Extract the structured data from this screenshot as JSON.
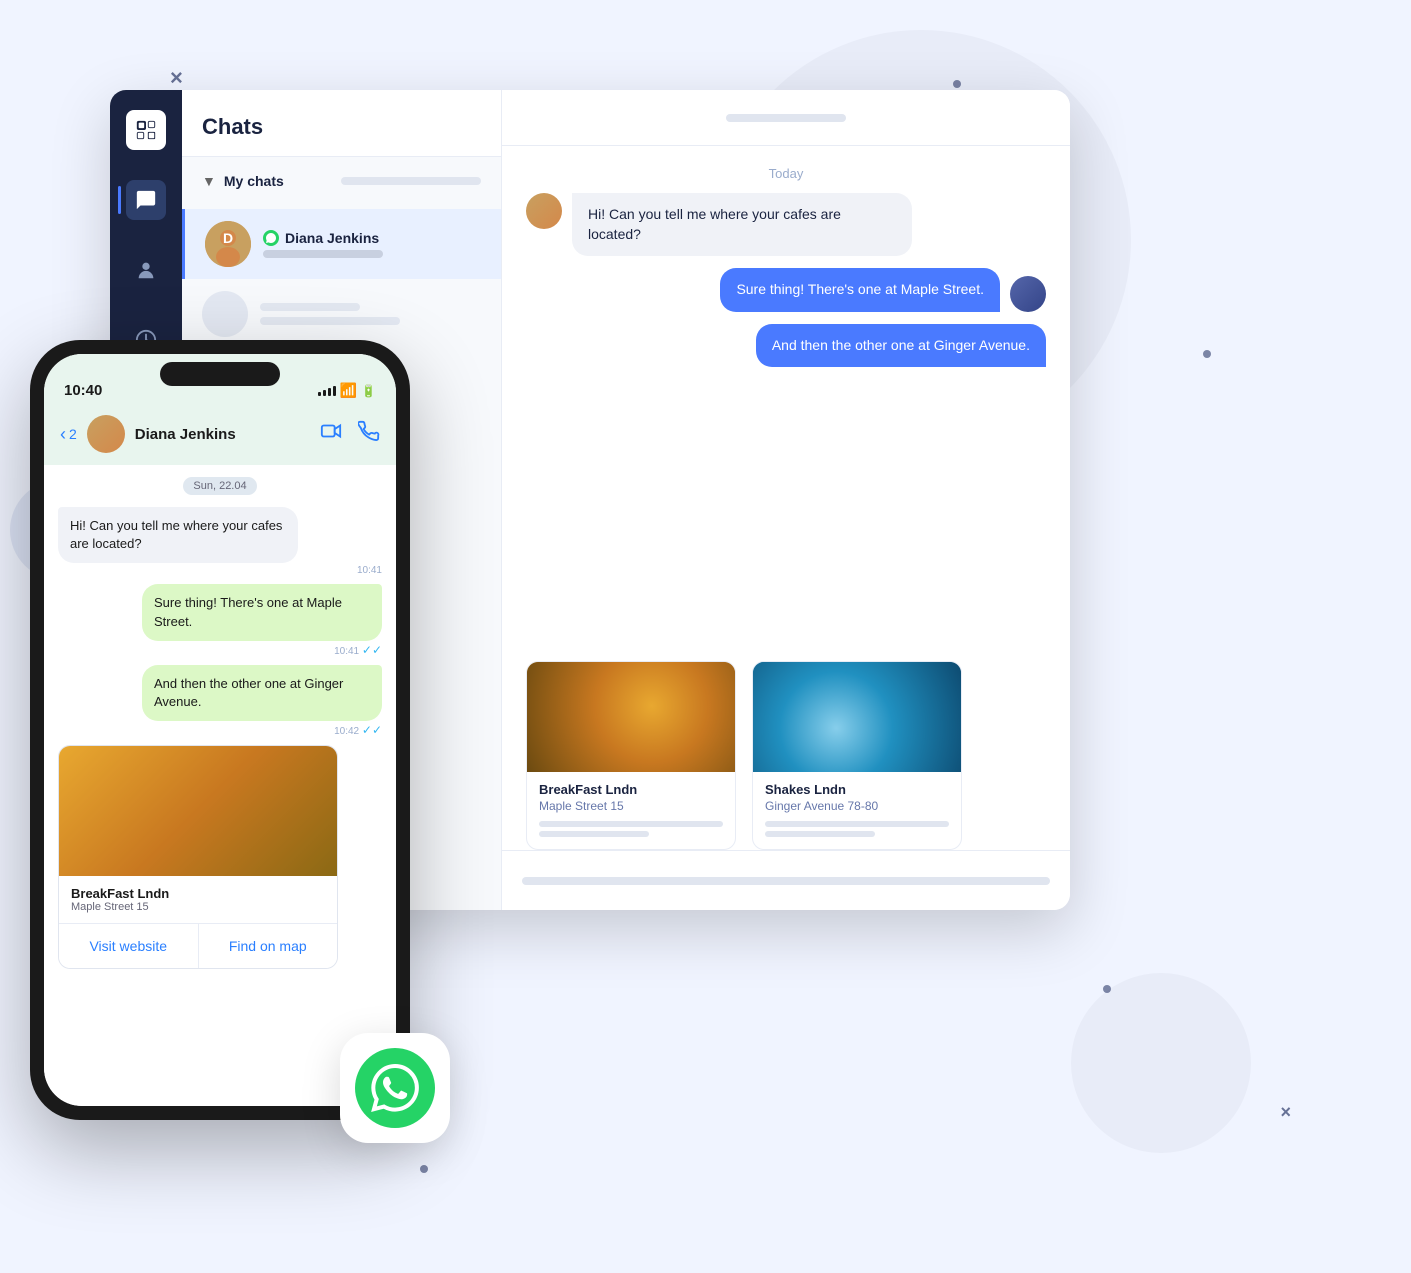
{
  "decorations": {
    "crosses": [
      "×",
      "×",
      "×",
      "×"
    ],
    "dots": 6
  },
  "sidebar": {
    "logo_icon": "chat-icon",
    "nav_items": [
      {
        "label": "Chats",
        "icon": "💬",
        "active": true
      },
      {
        "label": "Contacts",
        "icon": "👤",
        "active": false
      },
      {
        "label": "History",
        "icon": "🕐",
        "active": false
      }
    ]
  },
  "chat_sidebar": {
    "title": "Chats",
    "my_chats_label": "My chats",
    "contacts": [
      {
        "name": "Diana Jenkins",
        "channel": "whatsapp",
        "active": true
      },
      {
        "name": "",
        "active": false
      }
    ]
  },
  "chat_main": {
    "date_label": "Today",
    "messages": [
      {
        "type": "incoming",
        "text": "Hi! Can you tell me where your cafes are located?"
      },
      {
        "type": "outgoing",
        "text": "Sure thing! There's one at Maple Street."
      },
      {
        "type": "outgoing",
        "text": "And then the other one at Ginger Avenue."
      }
    ],
    "products": [
      {
        "name": "BreakFast Lndn",
        "address": "Maple Street 15"
      },
      {
        "name": "Shakes Lndn",
        "address": "Ginger Avenue 78-80"
      }
    ]
  },
  "phone": {
    "status_bar": {
      "time": "10:40"
    },
    "header": {
      "back_count": "2",
      "contact_name": "Diana Jenkins"
    },
    "date_label": "Sun, 22.04",
    "messages": [
      {
        "type": "incoming",
        "text": "Hi! Can you tell me where your cafes are located?",
        "time": "10:41"
      },
      {
        "type": "outgoing",
        "text": "Sure thing! There's one at Maple Street.",
        "time": "10:41",
        "read": true
      },
      {
        "type": "outgoing",
        "text": "And then the other one at Ginger Avenue.",
        "time": "10:42",
        "read": true
      }
    ],
    "product": {
      "name": "BreakFast Lndn",
      "address": "Maple Street 15"
    },
    "buttons": [
      {
        "label": "Visit website"
      },
      {
        "label": "Find on map"
      }
    ]
  }
}
